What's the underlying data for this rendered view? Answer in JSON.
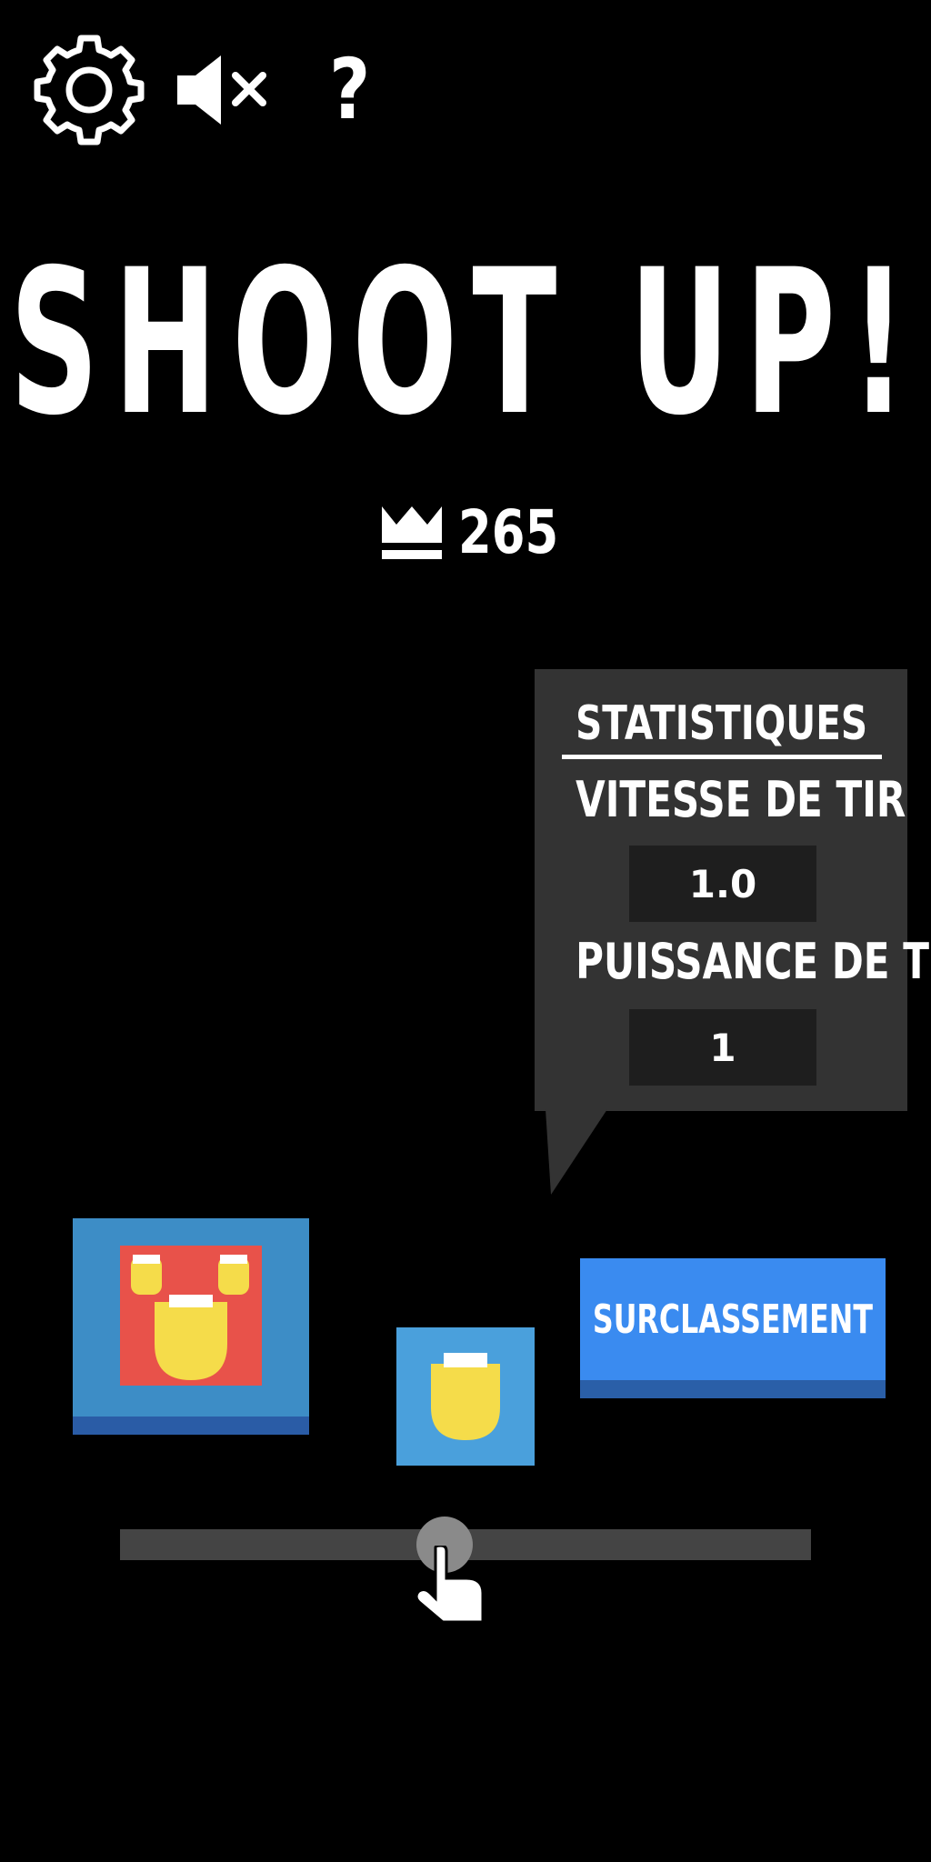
{
  "top_bar": {
    "settings_icon": "gear-icon",
    "sound_icon": "speaker-muted-icon",
    "help_icon": "question-mark-icon",
    "help_glyph": "?"
  },
  "title": "SHOOT UP!",
  "best": {
    "icon": "crown-icon",
    "score": "265"
  },
  "stats": {
    "heading": "STATISTIQUES",
    "fire_rate_label": "VITESSE DE TIR",
    "fire_rate_value": "1.0",
    "fire_power_label": "PUISSANCE DE TIR",
    "fire_power_value": "1"
  },
  "upgrade_button": "SURCLASSEMENT",
  "slider": {
    "level": 0.47,
    "hand_icon": "pointing-hand-icon"
  },
  "colors": {
    "background": "#000000",
    "panel": "#333333",
    "button_blue": "#3a8bf0",
    "character_red": "#e8524a",
    "character_yellow": "#f5dc4a",
    "tile_blue": "#4aa0dc"
  }
}
